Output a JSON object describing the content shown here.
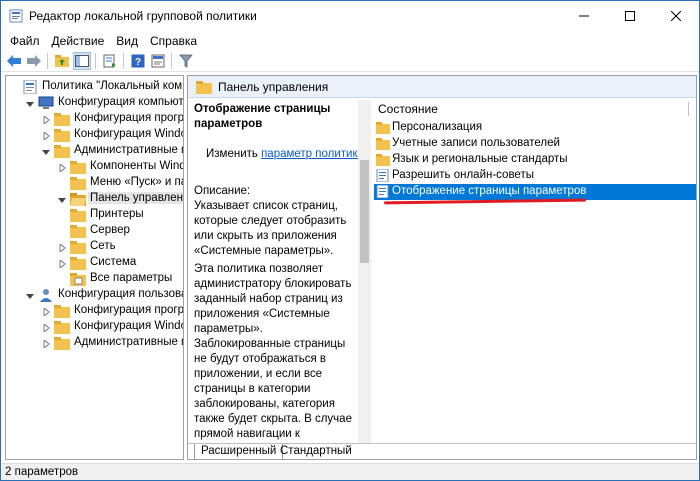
{
  "window": {
    "title": "Редактор локальной групповой политики"
  },
  "menu": [
    "Файл",
    "Действие",
    "Вид",
    "Справка"
  ],
  "tree": {
    "root": "Политика \"Локальный компьютер\"",
    "items": [
      {
        "label": "Политика \"Локальный компьютер\"",
        "icon": "policy-doc-icon",
        "expander": "none"
      },
      {
        "label": "Конфигурация компьютера",
        "icon": "computer-icon",
        "expander": "expanded"
      },
      {
        "label": "Конфигурация программ",
        "icon": "folder-icon",
        "expander": "collapsed"
      },
      {
        "label": "Конфигурация Windows",
        "icon": "folder-icon",
        "expander": "collapsed"
      },
      {
        "label": "Административные шаблоны",
        "icon": "folder-icon",
        "expander": "expanded"
      },
      {
        "label": "Компоненты Windows",
        "icon": "folder-icon",
        "expander": "collapsed"
      },
      {
        "label": "Меню «Пуск» и панель задач",
        "icon": "folder-icon",
        "expander": "none"
      },
      {
        "label": "Панель управления",
        "icon": "folder-open-icon",
        "expander": "expanded"
      },
      {
        "label": "Принтеры",
        "icon": "folder-icon",
        "expander": "none"
      },
      {
        "label": "Сервер",
        "icon": "folder-icon",
        "expander": "none"
      },
      {
        "label": "Сеть",
        "icon": "folder-icon",
        "expander": "collapsed"
      },
      {
        "label": "Система",
        "icon": "folder-icon",
        "expander": "collapsed"
      },
      {
        "label": "Все параметры",
        "icon": "settings-folder-icon",
        "expander": "none"
      },
      {
        "label": "Конфигурация пользователя",
        "icon": "user-icon",
        "expander": "expanded"
      },
      {
        "label": "Конфигурация программ",
        "icon": "folder-icon",
        "expander": "collapsed"
      },
      {
        "label": "Конфигурация Windows",
        "icon": "folder-icon",
        "expander": "collapsed"
      },
      {
        "label": "Административные шаблоны",
        "icon": "folder-icon",
        "expander": "collapsed"
      }
    ]
  },
  "pane": {
    "header": "Панель управления",
    "description": {
      "title": "Отображение страницы параметров",
      "edit_prefix": "Изменить",
      "edit_link": "параметр политики",
      "requirements": "Описание:\nУказывает список страниц, которые следует отобразить или скрыть из приложения «Системные параметры».",
      "body": "Эта политика позволяет администратору блокировать заданный набор страниц из приложения «Системные параметры». Заблокированные страницы не будут отображаться в приложении, и если все страницы в категории заблокированы, категория также будет скрыта. В случае прямой навигации к заблокированной странице через URI-адрес, контекстное меню в проводнике или другим"
    },
    "list_header": "Состояние",
    "list": [
      {
        "label": "Персонализация",
        "icon": "folder-icon",
        "selected": false
      },
      {
        "label": "Учетные записи пользователей",
        "icon": "folder-icon",
        "selected": false
      },
      {
        "label": "Язык и региональные стандарты",
        "icon": "folder-icon",
        "selected": false
      },
      {
        "label": "Разрешить онлайн-советы",
        "icon": "policy-setting-icon",
        "selected": false
      },
      {
        "label": "Отображение страницы параметров",
        "icon": "policy-setting-icon",
        "selected": true
      }
    ],
    "tabs": [
      "Расширенный",
      "Стандартный"
    ]
  },
  "status": "2 параметров",
  "colors": {
    "selection": "#0078d7",
    "link": "#0a5bc4",
    "annotation": "#e01b24",
    "folder": "#f1c24e"
  }
}
